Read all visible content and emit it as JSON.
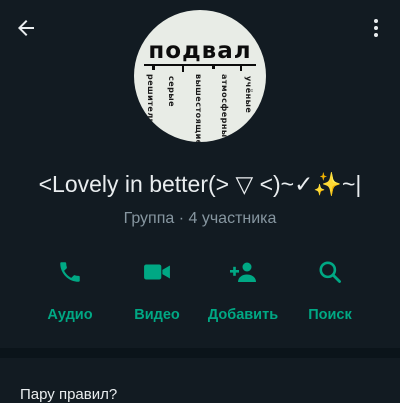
{
  "header": {
    "back_icon": "arrow-left-icon",
    "menu_icon": "vertical-dots-icon"
  },
  "avatar": {
    "title": "подвал",
    "words": [
      "решительные",
      "серые",
      "вышестоящие",
      "атмосферные",
      "учёные"
    ]
  },
  "group": {
    "name": "<Lovely in better(> ▽ <)~✓✨~|",
    "meta": "Группа · 4 участника"
  },
  "actions": [
    {
      "label": "Аудио",
      "icon": "phone-icon"
    },
    {
      "label": "Видео",
      "icon": "video-camera-icon"
    },
    {
      "label": "Добавить",
      "icon": "add-person-icon"
    },
    {
      "label": "Поиск",
      "icon": "search-icon"
    }
  ],
  "colors": {
    "background": "#121b22",
    "accent": "#00a884",
    "secondary_text": "#8696a0"
  },
  "section": {
    "title": "Пару правил?"
  }
}
